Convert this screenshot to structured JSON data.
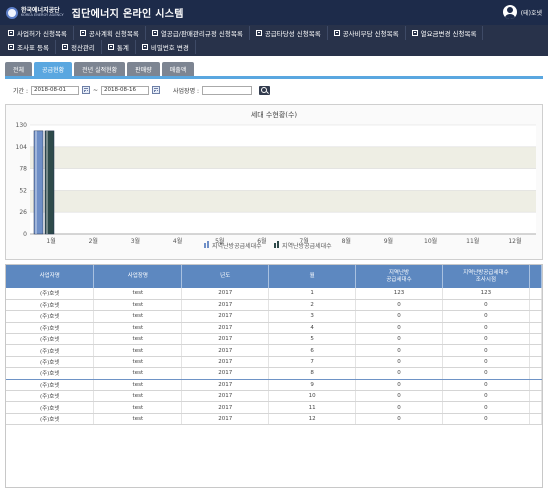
{
  "header": {
    "logo_line1": "한국에너지공단",
    "logo_line2": "KOREA ENERGY AGENCY",
    "title": "집단에너지 온라인 시스템",
    "user_name": "(테)호넷"
  },
  "menu": {
    "row1": [
      "사업허가 신청목록",
      "공사계획 신청목록",
      "열공급/판매관리규정 신청목록",
      "공급타당성 신청목록",
      "공사비부담 신청목록",
      "열요금변경 신청목록"
    ],
    "row2": [
      "조사표 등록",
      "정산관리",
      "통계",
      "비밀번호 변경"
    ]
  },
  "tabs": [
    "전체",
    "공급현황",
    "전년 실적현황",
    "판매량",
    "매출액"
  ],
  "active_tab": 1,
  "search": {
    "period_label": "기간 :",
    "date_from": "2018-08-01",
    "date_sep": "~",
    "date_to": "2018-08-16",
    "biz_label": "사업장명 :",
    "biz_value": ""
  },
  "chart_data": {
    "type": "bar",
    "title": "세대 수현황(수)",
    "categories": [
      "1월",
      "2월",
      "3월",
      "4월",
      "5월",
      "6월",
      "7월",
      "8월",
      "9월",
      "10월",
      "11월",
      "12월"
    ],
    "series": [
      {
        "name": "지역난방공급세대수",
        "values": [
          123,
          0,
          0,
          0,
          0,
          0,
          0,
          0,
          0,
          0,
          0,
          0
        ],
        "color": "#6f8fc7"
      },
      {
        "name": "지역난방공급세대수",
        "values": [
          123,
          0,
          0,
          0,
          0,
          0,
          0,
          0,
          0,
          0,
          0,
          0
        ],
        "color": "#2e4a4a"
      }
    ],
    "ylim": [
      0,
      130
    ],
    "yticks": [
      0,
      26,
      52,
      78,
      104,
      130
    ],
    "grid": true,
    "legend_position": "bottom"
  },
  "table": {
    "headers": [
      "사업자명",
      "사업장명",
      "년도",
      "월",
      "지역난방\n공급세대수",
      "지역난방공급세대수\n조사시점"
    ],
    "rows": [
      [
        "(주)호넷",
        "test",
        "2017",
        "1",
        "123",
        "123"
      ],
      [
        "(주)호넷",
        "test",
        "2017",
        "2",
        "0",
        "0"
      ],
      [
        "(주)호넷",
        "test",
        "2017",
        "3",
        "0",
        "0"
      ],
      [
        "(주)호넷",
        "test",
        "2017",
        "4",
        "0",
        "0"
      ],
      [
        "(주)호넷",
        "test",
        "2017",
        "5",
        "0",
        "0"
      ],
      [
        "(주)호넷",
        "test",
        "2017",
        "6",
        "0",
        "0"
      ],
      [
        "(주)호넷",
        "test",
        "2017",
        "7",
        "0",
        "0"
      ],
      [
        "(주)호넷",
        "test",
        "2017",
        "8",
        "0",
        "0"
      ],
      [
        "(주)호넷",
        "test",
        "2017",
        "9",
        "0",
        "0"
      ],
      [
        "(주)호넷",
        "test",
        "2017",
        "10",
        "0",
        "0"
      ],
      [
        "(주)호넷",
        "test",
        "2017",
        "11",
        "0",
        "0"
      ],
      [
        "(주)호넷",
        "test",
        "2017",
        "12",
        "0",
        "0"
      ]
    ]
  }
}
